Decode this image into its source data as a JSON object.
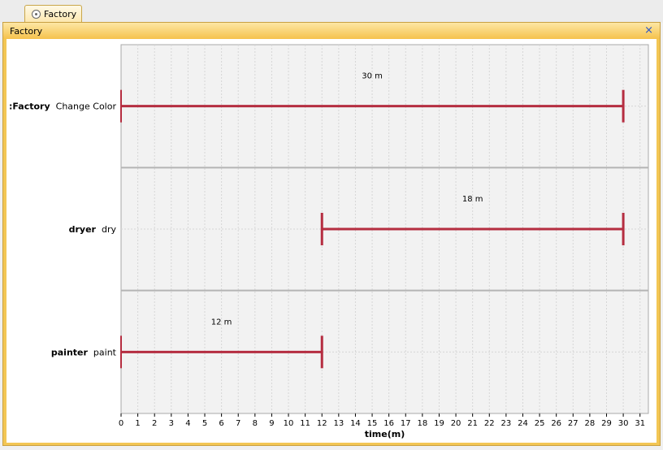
{
  "tab": {
    "label": "Factory",
    "icon": "component-icon"
  },
  "panel": {
    "title": "Factory",
    "close_glyph": "×"
  },
  "chart_data": {
    "type": "gantt",
    "title": "",
    "xlabel": "time(m)",
    "xlim": [
      0,
      31.5
    ],
    "xticks": [
      0,
      1,
      2,
      3,
      4,
      5,
      6,
      7,
      8,
      9,
      10,
      11,
      12,
      13,
      14,
      15,
      16,
      17,
      18,
      19,
      20,
      21,
      22,
      23,
      24,
      25,
      26,
      27,
      28,
      29,
      30,
      31
    ],
    "grid": true,
    "bar_color": "#b52d40",
    "lanes": [
      {
        "name": ":Factory",
        "task": "Change Color",
        "start": 0,
        "end": 30,
        "duration_label": "30 m"
      },
      {
        "name": "dryer",
        "task": "dry",
        "start": 12,
        "end": 30,
        "duration_label": "18 m"
      },
      {
        "name": "painter",
        "task": "paint",
        "start": 0,
        "end": 12,
        "duration_label": "12 m"
      }
    ]
  }
}
